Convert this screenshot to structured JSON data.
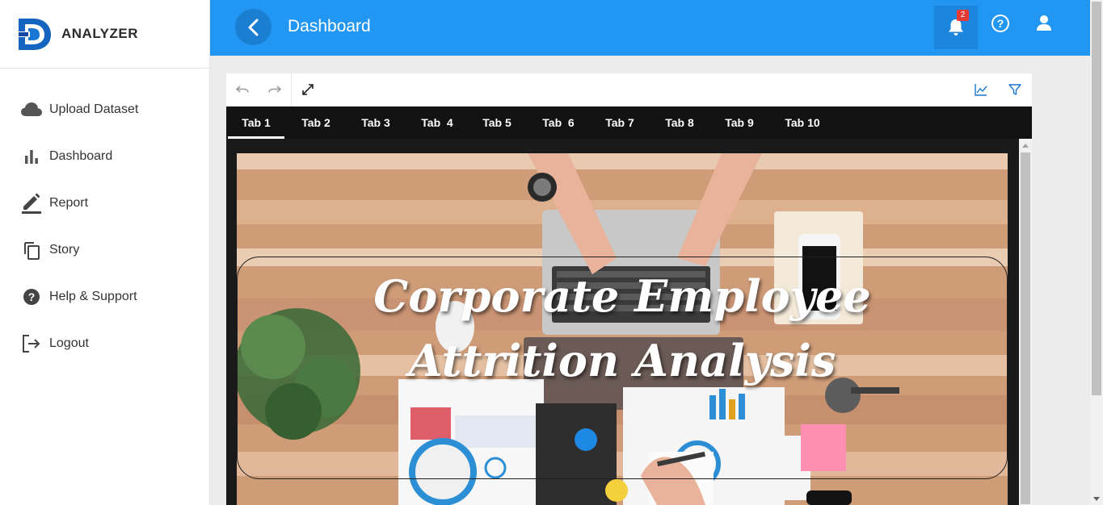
{
  "brand": {
    "name": "ANALYZER"
  },
  "sidebar": {
    "items": [
      {
        "label": "Upload Dataset",
        "icon": "cloud-icon"
      },
      {
        "label": "Dashboard",
        "icon": "bar-chart-icon"
      },
      {
        "label": "Report",
        "icon": "pencil-icon"
      },
      {
        "label": "Story",
        "icon": "copy-icon"
      },
      {
        "label": "Help & Support",
        "icon": "help-circle-icon"
      },
      {
        "label": "Logout",
        "icon": "logout-icon"
      }
    ]
  },
  "header": {
    "title": "Dashboard",
    "notification_count": "2",
    "colors": {
      "bar": "#2196f3",
      "badge": "#e53935"
    }
  },
  "toolbar": {
    "left_icons": [
      "undo-icon",
      "redo-icon",
      "fullscreen-icon"
    ],
    "right_icons": [
      "line-chart-icon",
      "filter-icon"
    ]
  },
  "tabs": [
    {
      "label": "Tab 1",
      "active": true
    },
    {
      "label": "Tab 2"
    },
    {
      "label": "Tab 3"
    },
    {
      "label": "Tab  4"
    },
    {
      "label": "Tab 5"
    },
    {
      "label": "Tab  6"
    },
    {
      "label": "Tab 7"
    },
    {
      "label": "Tab 8"
    },
    {
      "label": "Tab 9"
    },
    {
      "label": "Tab 10"
    }
  ],
  "hero": {
    "line1": "Corporate Employee",
    "line2": "Attrition Analysis"
  }
}
